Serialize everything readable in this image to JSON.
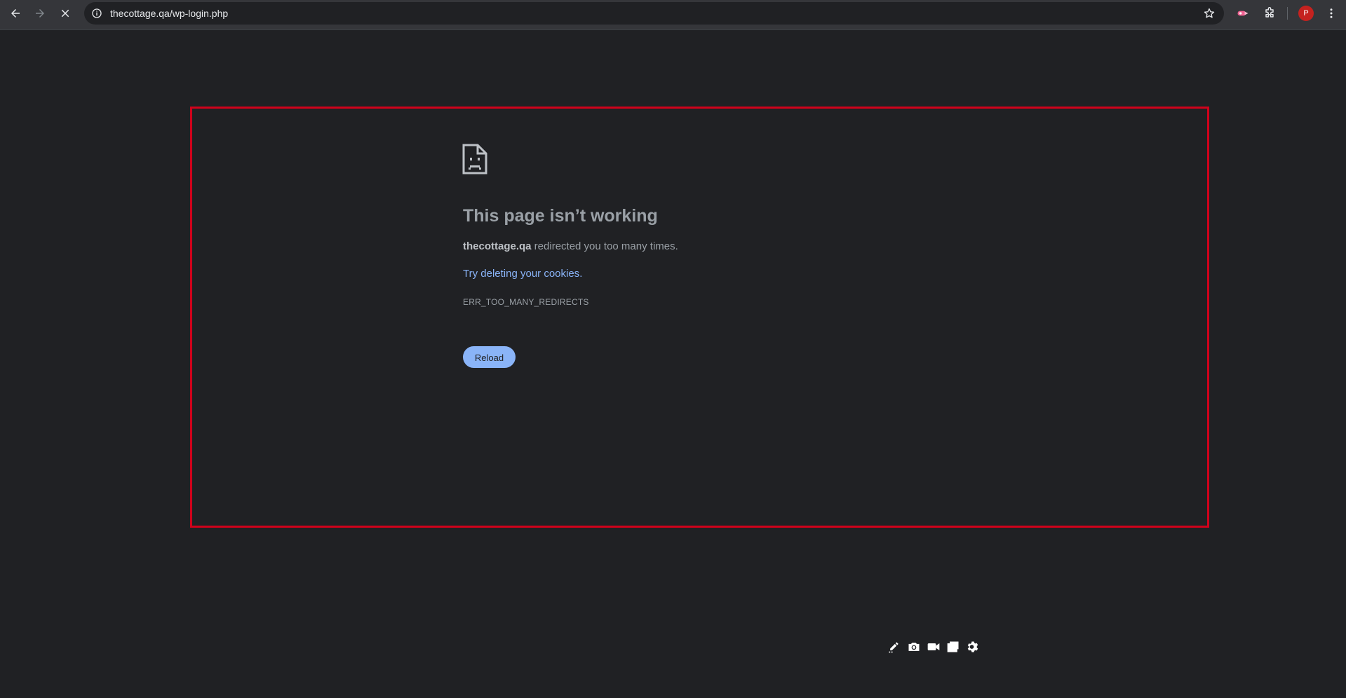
{
  "browser": {
    "url_host": "thecottage.qa",
    "url_path": "/wp-login.php",
    "profile_initial": "P",
    "icons": {
      "back": "arrow-left-icon",
      "forward": "arrow-right-icon",
      "stop": "close-icon",
      "info": "info-icon",
      "bookmark": "star-icon",
      "extension": "extension-icon",
      "puzzle": "puzzle-icon",
      "menu": "more-vert-icon"
    },
    "colors": {
      "toolbar": "#35363a",
      "omnibox": "#202124",
      "avatar": "#c5221f"
    }
  },
  "error_page": {
    "title": "This page isn’t working",
    "host": "thecottage.qa",
    "message": " redirected you too many times.",
    "suggestion_link": "Try deleting your cookies",
    "suggestion_end": ".",
    "error_code": "ERR_TOO_MANY_REDIRECTS",
    "reload_label": "Reload",
    "icon": "sad-document-icon",
    "colors": {
      "background": "#202124",
      "text": "#9aa0a6",
      "link": "#8ab4f8",
      "button": "#8ab4f8",
      "highlight": "#d0021b"
    }
  },
  "capture_toolbar": {
    "icons": [
      "edit-icon",
      "camera-icon",
      "video-icon",
      "window-icon",
      "gear-icon"
    ]
  }
}
